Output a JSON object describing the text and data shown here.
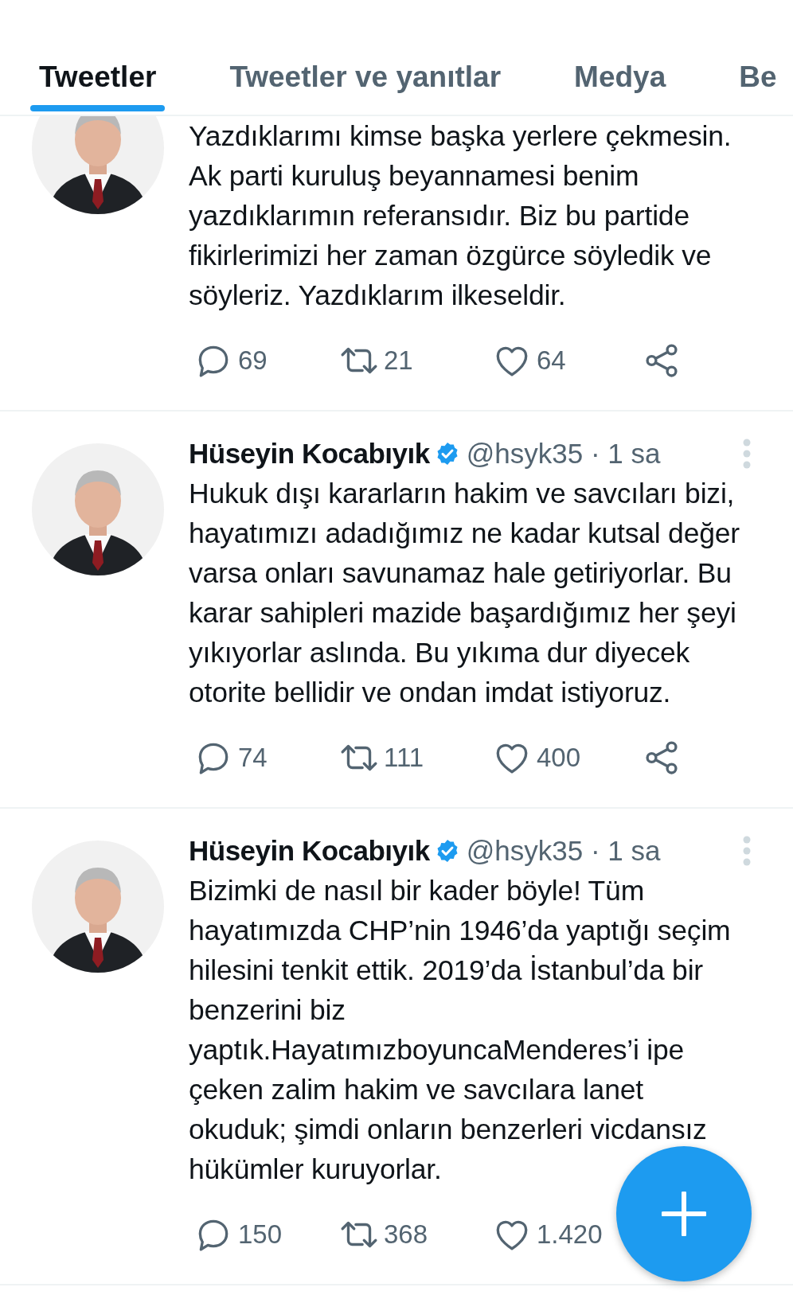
{
  "tabs": [
    {
      "label": "Tweetler",
      "selected": true
    },
    {
      "label": "Tweetler ve yanıtlar",
      "selected": false
    },
    {
      "label": "Medya",
      "selected": false
    },
    {
      "label": "Be",
      "selected": false
    }
  ],
  "tweets": [
    {
      "text": "Yazdıklarımı kimse başka yerlere çekmesin.\nAk parti kuruluş beyannamesi benim\nyazdıklarımın referansıdır. Biz bu partide\nfikirlerimizi her zaman özgürce söyledik ve\nsöyleriz. Yazdıklarım ilkeseldir.",
      "replies": "69",
      "retweets": "21",
      "likes": "64",
      "share": true
    },
    {
      "author": "Hüseyin Kocabıyık",
      "verified": true,
      "meta": "@hsyk35 · 1 sa",
      "text": "Hukuk dışı kararların hakim ve savcıları bizi,\nhayatımızı adadığımız ne kadar kutsal değer\nvarsa onları savunamaz hale getiriyorlar. Bu\nkarar sahipleri mazide başardığımız her şeyi\nyıkıyorlar aslında. Bu yıkıma dur diyecek\notorite bellidir ve ondan imdat istiyoruz.",
      "replies": "74",
      "retweets": "111",
      "likes": "400",
      "share": true
    },
    {
      "author": "Hüseyin Kocabıyık",
      "verified": true,
      "meta": "@hsyk35 · 1 sa",
      "text": "Bizimki de nasıl bir kader böyle! Tüm\nhayatımızda CHP’nin 1946’da yaptığı seçim\nhilesini tenkit ettik. 2019’da İstanbul’da bir\nbenzerini biz\nyaptık.HayatımızboyuncaMenderes’i ipe\nçeken zalim hakim ve savcılara lanet\nokuduk; şimdi onların benzerleri vicdansız\nhükümler kuruyorlar.",
      "replies": "150",
      "retweets": "368",
      "likes": "1.420",
      "share": false
    }
  ]
}
